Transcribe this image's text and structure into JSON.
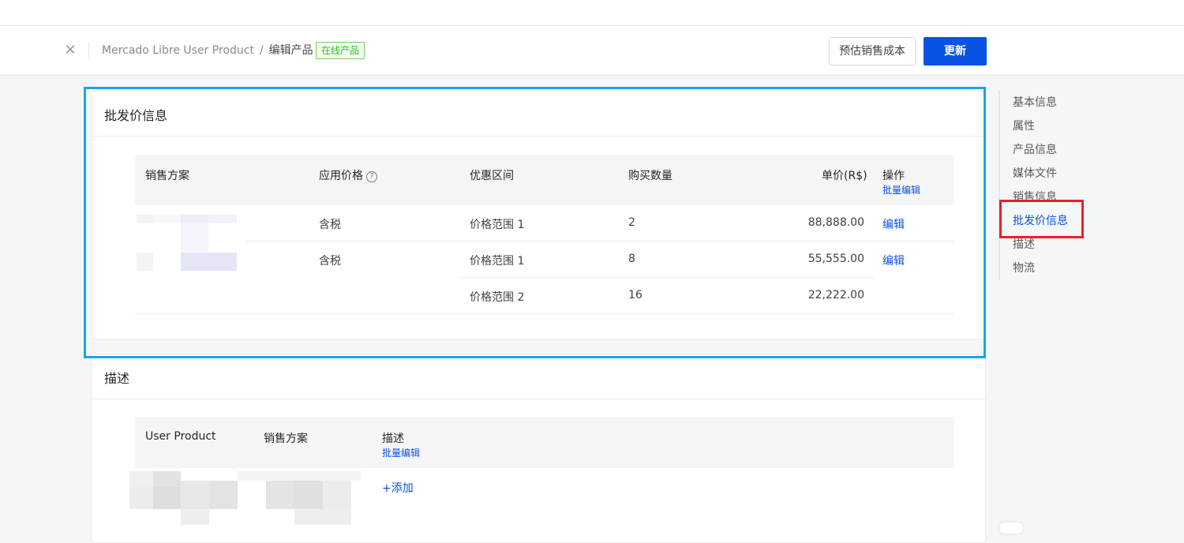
{
  "header": {
    "breadcrumb_root": "Mercado Libre User Product",
    "breadcrumb_sep": "/",
    "breadcrumb_current": "编辑产品",
    "status_badge": "在线产品",
    "estimate_button": "预估销售成本",
    "update_button": "更新"
  },
  "wholesale": {
    "title": "批发价信息",
    "columns": {
      "plan": "销售方案",
      "applied_price": "应用价格",
      "range": "优惠区间",
      "quantity": "购买数量",
      "unit_price": "单价(R$)",
      "action": "操作",
      "bulk_edit": "批量编辑"
    },
    "rows": [
      {
        "applied_price": "含税",
        "range": "价格范围 1",
        "quantity": "2",
        "unit_price": "88,888.00",
        "action": "编辑"
      },
      {
        "applied_price": "含税",
        "range": "价格范围 1",
        "quantity": "8",
        "unit_price": "55,555.00",
        "action": "编辑"
      },
      {
        "applied_price": "",
        "range": "价格范围 2",
        "quantity": "16",
        "unit_price": "22,222.00",
        "action": ""
      }
    ]
  },
  "description": {
    "title": "描述",
    "columns": {
      "user_product": "User Product",
      "plan": "销售方案",
      "description": "描述",
      "bulk_edit": "批量编辑"
    },
    "add_link": "+添加"
  },
  "anchor_nav": {
    "items": [
      "基本信息",
      "属性",
      "产品信息",
      "媒体文件",
      "销售信息",
      "批发价信息",
      "描述",
      "物流"
    ],
    "active_index": 5
  },
  "colors": {
    "primary": "#0a52e6",
    "badge_green": "#36b82c",
    "highlight_blue": "#1aa3e8",
    "highlight_red": "#e8202a"
  }
}
